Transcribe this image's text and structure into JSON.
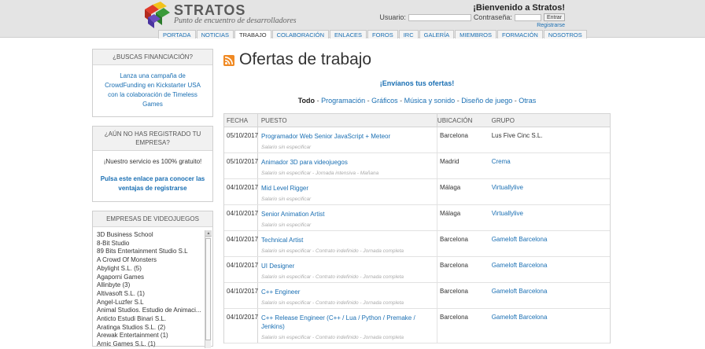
{
  "header": {
    "brand": "STRATOS",
    "tagline": "Punto de encuentro de desarrolladores",
    "welcome": "¡Bienvenido a Stratos!",
    "user_label": "Usuario:",
    "password_label": "Contraseña:",
    "enter_label": "Entrar",
    "register_label": "Registrarse"
  },
  "nav": [
    "PORTADA",
    "NOTICIAS",
    "TRABAJO",
    "COLABORACIÓN",
    "ENLACES",
    "FOROS",
    "IRC",
    "GALERÍA",
    "MIEMBROS",
    "FORMACIÓN",
    "NOSOTROS"
  ],
  "sidebar": {
    "funding_title": "¿BUSCAS FINANCIACIÓN?",
    "funding_text": "Lanza una campaña de CrowdFunding en Kickstarter USA con la colaboración de Timeless Games",
    "register_title": "¿AÚN NO HAS REGISTRADO TU EMPRESA?",
    "register_free": "¡Nuestro servicio es 100% gratuito!",
    "register_link": "Pulsa este enlace para conocer las ventajas de registrarse",
    "companies_title": "EMPRESAS DE VIDEOJUEGOS",
    "companies": [
      "3D Business School",
      "8-Bit Studio",
      "89 Bits Entertainment Studio S.L",
      "A Crowd Of Monsters",
      "Abylight S.L. (5)",
      "Agaporni Games",
      "Allinbyte (3)",
      "Altivasoft S.L. (1)",
      "Angel-Luzfer S.L",
      "Animal Studios. Estudio de Animaci...",
      "Anticto Estudi Binari S.L.",
      "Aratinga Studios S.L. (2)",
      "Arewak Entertainment (1)",
      "Arnic Games S.L. (1)"
    ]
  },
  "main": {
    "title": "Ofertas de trabajo",
    "send_offers": "¡Envíanos tus ofertas!",
    "filters": [
      "Todo",
      "Programación",
      "Gráficos",
      "Música y sonido",
      "Diseño de juego",
      "Otras"
    ],
    "columns": [
      "FECHA",
      "PUESTO",
      "UBICACIÓN",
      "GRUPO"
    ],
    "jobs": [
      {
        "date": "05/10/2017",
        "title": "Programador Web Senior JavaScript + Meteor",
        "note": "Salario sin especificar",
        "location": "Barcelona",
        "group": "Lus Five Cinc S.L."
      },
      {
        "date": "05/10/2017",
        "title": "Animador 3D para videojuegos",
        "note": "Salario sin especificar - Jornada intensiva - Mañana",
        "location": "Madrid",
        "group": "Crema"
      },
      {
        "date": "04/10/2017",
        "title": "Mid Level Rigger",
        "note": "Salario sin especificar",
        "location": "Málaga",
        "group": "Virtuallylive"
      },
      {
        "date": "04/10/2017",
        "title": "Senior Animation Artist",
        "note": "Salario sin especificar",
        "location": "Málaga",
        "group": "Virtuallylive"
      },
      {
        "date": "04/10/2017",
        "title": "Technical Artist",
        "note": "Salario sin especificar - Contrato indefinido - Jornada completa",
        "location": "Barcelona",
        "group": "Gameloft Barcelona"
      },
      {
        "date": "04/10/2017",
        "title": "UI Designer",
        "note": "Salario sin especificar - Contrato indefinido - Jornada completa",
        "location": "Barcelona",
        "group": "Gameloft Barcelona"
      },
      {
        "date": "04/10/2017",
        "title": "C++ Engineer",
        "note": "Salario sin especificar - Contrato indefinido - Jornada completa",
        "location": "Barcelona",
        "group": "Gameloft Barcelona"
      },
      {
        "date": "04/10/2017",
        "title": "C++ Release Engineer (C++ / Lua / Python / Premake / Jenkins)",
        "note": "Salario sin especificar - Contrato indefinido - Jornada completa",
        "location": "Barcelona",
        "group": "Gameloft Barcelona"
      }
    ]
  }
}
